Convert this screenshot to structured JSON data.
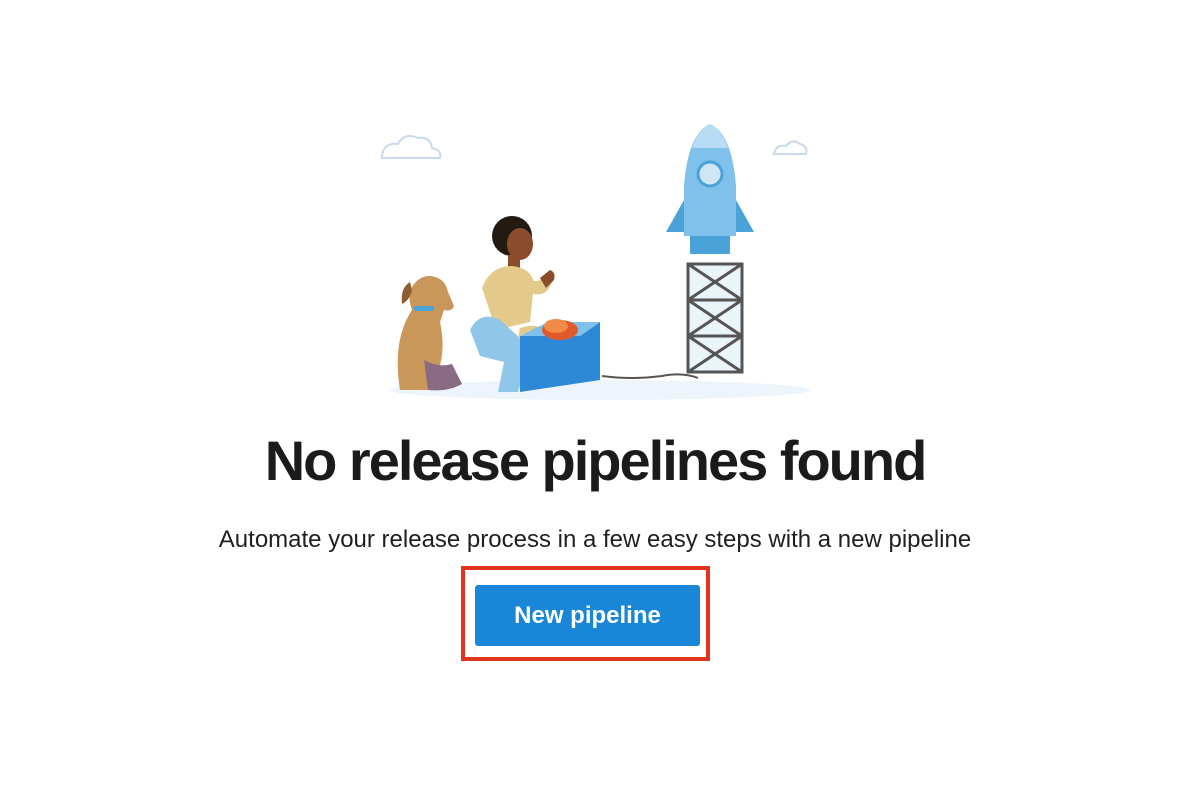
{
  "empty_state": {
    "title": "No release pipelines found",
    "subtitle": "Automate your release process in a few easy steps with a new pipeline",
    "button_label": "New pipeline"
  },
  "colors": {
    "button": "#1a86d8",
    "highlight_border": "#e0341f",
    "title_text": "#1b1b1b"
  },
  "illustration": {
    "icons": [
      "cloud-icon",
      "dog-icon",
      "person-icon",
      "launch-box-icon",
      "rocket-icon",
      "launch-tower-icon"
    ]
  }
}
